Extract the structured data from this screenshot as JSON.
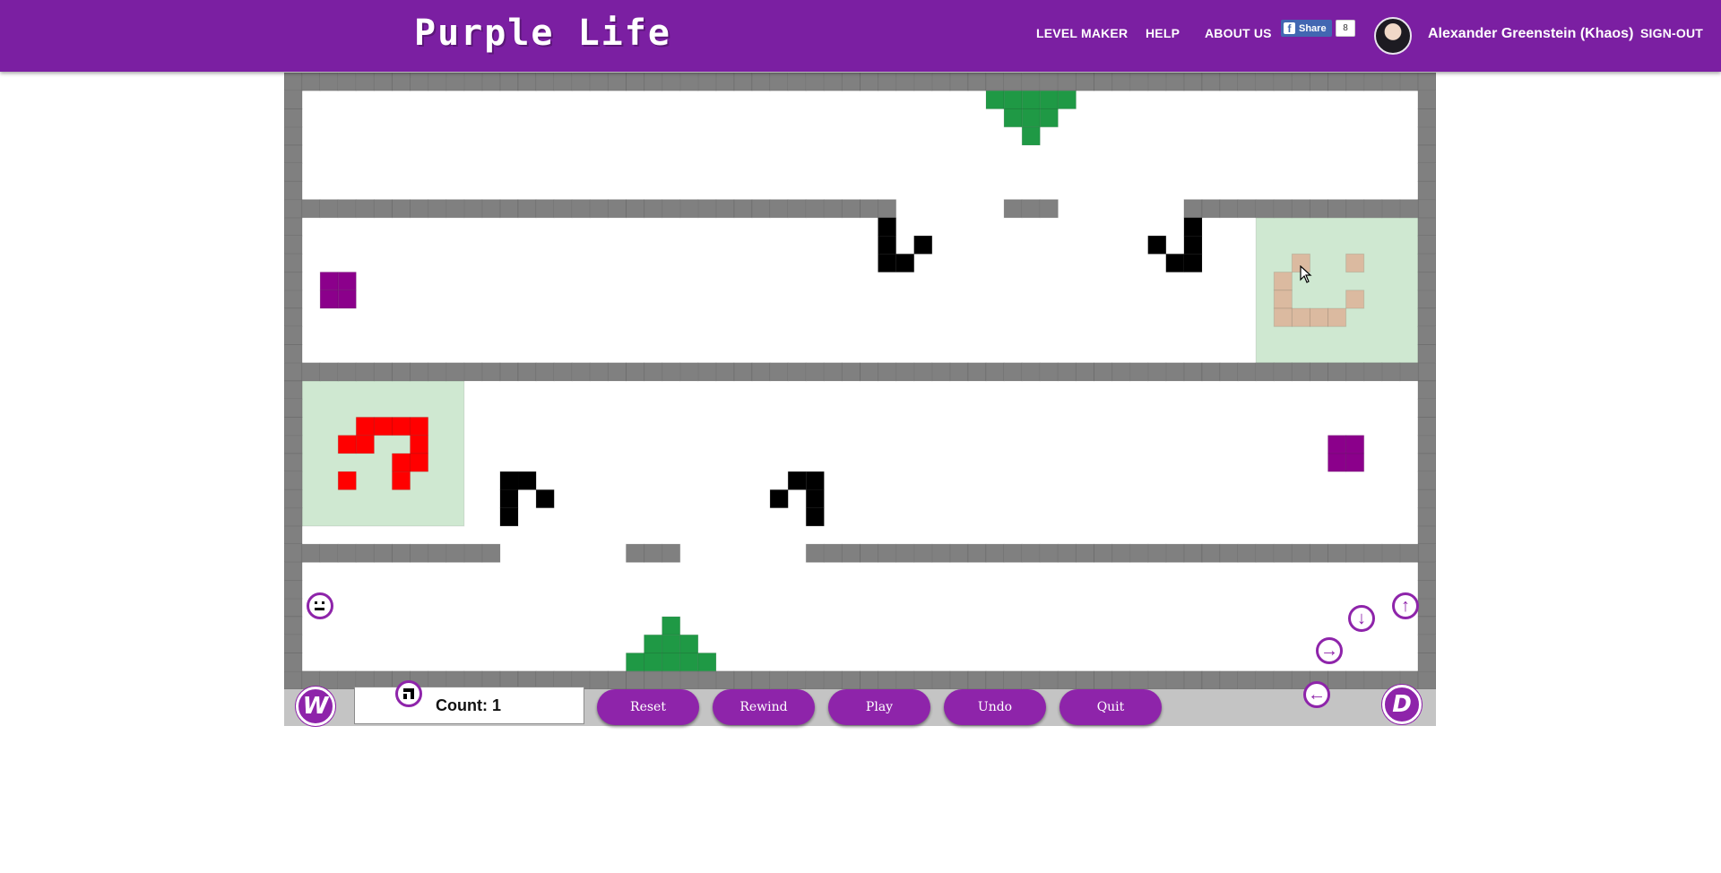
{
  "header": {
    "logo": "Purple Life",
    "nav": [
      "LEVEL MAKER",
      "HELP",
      "ABOUT US"
    ],
    "facebook": {
      "share_label": "Share",
      "share_count": "8"
    },
    "user_name": "Alexander Greenstein (Khaos)",
    "signout": "SIGN-OUT"
  },
  "game": {
    "counter_label": "Count: 1",
    "buttons": [
      "Reset",
      "Rewind",
      "Play",
      "Undo",
      "Quit"
    ],
    "direction_left": "W",
    "direction_right": "D",
    "arrows": {
      "up": "↑",
      "down": "↓",
      "right": "→",
      "left": "←"
    },
    "colors": {
      "wall": "#808080",
      "live_cell": "#000000",
      "player": "#8b008b",
      "goal_zone": "#cfe8d1",
      "target_red": "#ff0000",
      "target_tan": "#dbbaa0",
      "spawner_green": "#1f9945",
      "brand": "#7b1fa2",
      "button": "#8e24aa"
    }
  }
}
